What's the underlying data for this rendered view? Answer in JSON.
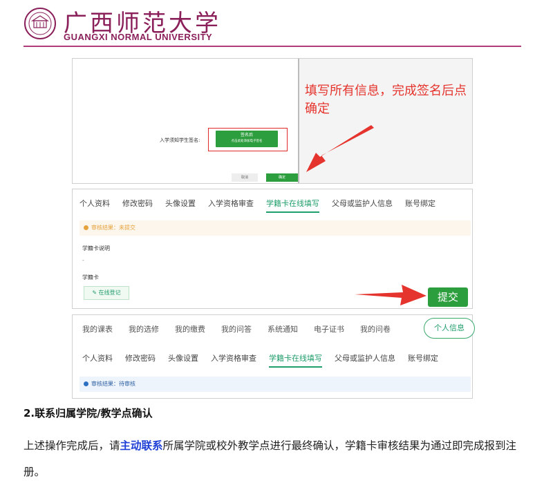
{
  "header": {
    "logo_cn": "广西师范大学",
    "logo_en": "GUANGXI NORMAL UNIVERSITY",
    "brand_color": "#8a1f5a"
  },
  "panel1": {
    "sign_label": "入学须知学生签名:",
    "sign_button_line1": "签名后",
    "sign_button_line2": "点击此处添加电子签名",
    "cancel_label": "取消",
    "ok_label": "确定",
    "instruction": "填写所有信息，完成签名后点确定"
  },
  "tabs": [
    {
      "label": "个人资料"
    },
    {
      "label": "修改密码"
    },
    {
      "label": "头像设置"
    },
    {
      "label": "入学资格审查"
    },
    {
      "label": "学籍卡在线填写"
    },
    {
      "label": "父母或监护人信息"
    },
    {
      "label": "账号绑定"
    }
  ],
  "panel2": {
    "notice": "审核结果：未提交",
    "desc_label": "学籍卡说明",
    "desc_value": "-",
    "card_label": "学籍卡",
    "online_register": "在线登记",
    "submit_label": "提交"
  },
  "panel3": {
    "nav": [
      {
        "label": "我的课表"
      },
      {
        "label": "我的选修"
      },
      {
        "label": "我的缴费"
      },
      {
        "label": "我的问答"
      },
      {
        "label": "系统通知"
      },
      {
        "label": "电子证书"
      },
      {
        "label": "我的问卷"
      }
    ],
    "nav_active": "个人信息",
    "notice": "审核结果：待审核"
  },
  "section": {
    "title": "2.联系归属学院/教学点确认",
    "para_before": "上述操作完成后，请",
    "para_highlight": "主动联系",
    "para_after": "所属学院或校外教学点进行最终确认，学籍卡审核结果为通过即完成报到注册。"
  },
  "colors": {
    "accent_green": "#2d9e3e",
    "arrow_red": "#e5342d",
    "highlight_blue": "#1e3fd6"
  }
}
